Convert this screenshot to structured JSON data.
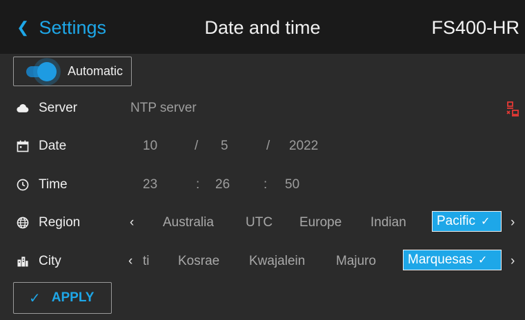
{
  "header": {
    "back_label": "Settings",
    "title": "Date and time",
    "device": "FS400-HR"
  },
  "automatic": {
    "label": "Automatic",
    "enabled": true
  },
  "server": {
    "label": "Server",
    "placeholder": "NTP server",
    "status_icon": "network-disconnected-icon"
  },
  "date": {
    "label": "Date",
    "day": "10",
    "month": "5",
    "year": "2022",
    "separator": "/"
  },
  "time": {
    "label": "Time",
    "hour": "23",
    "minute": "26",
    "second": "50",
    "separator": ":"
  },
  "region": {
    "label": "Region",
    "options": [
      "Australia",
      "UTC",
      "Europe",
      "Indian"
    ],
    "selected": "Pacific"
  },
  "city": {
    "label": "City",
    "partial": "ti",
    "options": [
      "Kosrae",
      "Kwajalein",
      "Majuro"
    ],
    "selected": "Marquesas"
  },
  "apply": {
    "label": "APPLY"
  },
  "colors": {
    "accent": "#1ea7e8",
    "background": "#2b2b2b",
    "header": "#1a1a1a",
    "error": "#e53935"
  }
}
